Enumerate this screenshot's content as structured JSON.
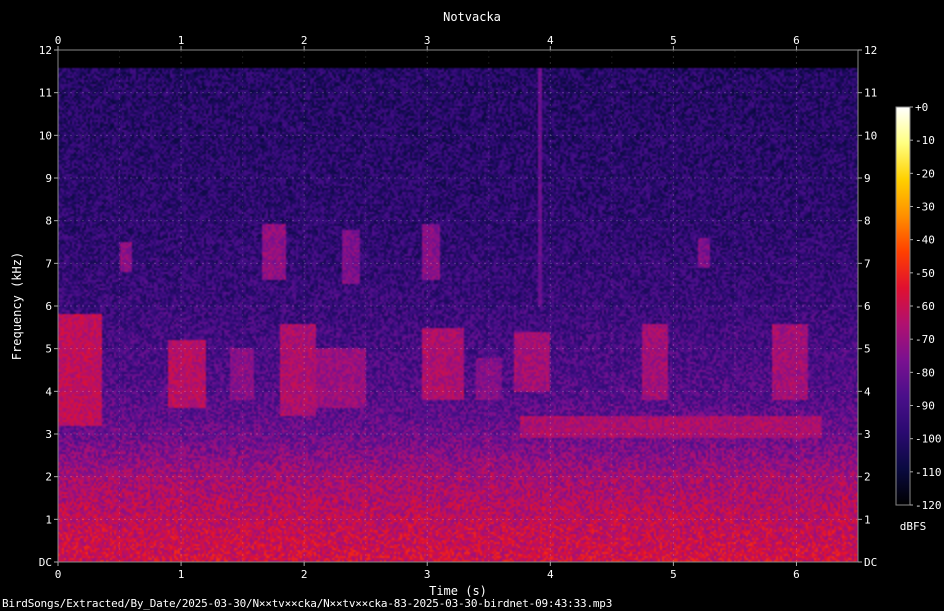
{
  "chart_data": {
    "type": "heatmap",
    "title": "Notvacka",
    "xlabel": "Time (s)",
    "ylabel": "Frequency (kHz)",
    "xlim": [
      0,
      6.5
    ],
    "ylim": [
      0,
      12
    ],
    "x_ticks": [
      {
        "value": 0,
        "label": "0"
      },
      {
        "value": 1,
        "label": "1"
      },
      {
        "value": 2,
        "label": "2"
      },
      {
        "value": 3,
        "label": "3"
      },
      {
        "value": 4,
        "label": "4"
      },
      {
        "value": 5,
        "label": "5"
      },
      {
        "value": 6,
        "label": "6"
      }
    ],
    "y_ticks": [
      {
        "value": 0,
        "label": "DC"
      },
      {
        "value": 1,
        "label": "1"
      },
      {
        "value": 2,
        "label": "2"
      },
      {
        "value": 3,
        "label": "3"
      },
      {
        "value": 4,
        "label": "4"
      },
      {
        "value": 5,
        "label": "5"
      },
      {
        "value": 6,
        "label": "6"
      },
      {
        "value": 7,
        "label": "7"
      },
      {
        "value": 8,
        "label": "8"
      },
      {
        "value": 9,
        "label": "9"
      },
      {
        "value": 10,
        "label": "10"
      },
      {
        "value": 11,
        "label": "11"
      },
      {
        "value": 12,
        "label": "12"
      }
    ],
    "colorbar": {
      "label": "dBFS",
      "range": [
        -120,
        0
      ],
      "ticks": [
        {
          "value": 0,
          "label": "+0"
        },
        {
          "value": -10,
          "label": "-10"
        },
        {
          "value": -20,
          "label": "-20"
        },
        {
          "value": -30,
          "label": "-30"
        },
        {
          "value": -40,
          "label": "-40"
        },
        {
          "value": -50,
          "label": "-50"
        },
        {
          "value": -60,
          "label": "-60"
        },
        {
          "value": -70,
          "label": "-70"
        },
        {
          "value": -80,
          "label": "-80"
        },
        {
          "value": -90,
          "label": "-90"
        },
        {
          "value": -100,
          "label": "-100"
        },
        {
          "value": -110,
          "label": "-110"
        },
        {
          "value": -120,
          "label": "-120"
        }
      ],
      "colormap": [
        "#000000",
        "#0a0a40",
        "#2a0a70",
        "#4a0f8a",
        "#7a1090",
        "#b01070",
        "#e01030",
        "#ff4000",
        "#ff9000",
        "#ffd000",
        "#ffff80",
        "#ffffff"
      ]
    },
    "grid": true,
    "signal_top_khz": 11.6,
    "noise_floor_dbfs": [
      {
        "khz": 0,
        "dbfs": -58
      },
      {
        "khz": 1,
        "dbfs": -62
      },
      {
        "khz": 2,
        "dbfs": -68
      },
      {
        "khz": 3,
        "dbfs": -80
      },
      {
        "khz": 4,
        "dbfs": -86
      },
      {
        "khz": 5,
        "dbfs": -89
      },
      {
        "khz": 6,
        "dbfs": -93
      },
      {
        "khz": 8,
        "dbfs": -97
      },
      {
        "khz": 11.6,
        "dbfs": -100
      }
    ],
    "events": [
      {
        "t0": 0.0,
        "t1": 0.35,
        "f0": 3.2,
        "f1": 5.8,
        "dbfs": -62
      },
      {
        "t0": 0.5,
        "t1": 0.6,
        "f0": 6.8,
        "f1": 7.5,
        "dbfs": -72
      },
      {
        "t0": 0.9,
        "t1": 1.2,
        "f0": 3.6,
        "f1": 5.2,
        "dbfs": -64
      },
      {
        "t0": 1.4,
        "t1": 1.6,
        "f0": 3.8,
        "f1": 5.0,
        "dbfs": -74
      },
      {
        "t0": 1.65,
        "t1": 1.85,
        "f0": 6.6,
        "f1": 7.9,
        "dbfs": -72
      },
      {
        "t0": 1.8,
        "t1": 2.1,
        "f0": 3.4,
        "f1": 5.6,
        "dbfs": -66
      },
      {
        "t0": 2.1,
        "t1": 2.5,
        "f0": 3.6,
        "f1": 5.0,
        "dbfs": -70
      },
      {
        "t0": 2.3,
        "t1": 2.45,
        "f0": 6.5,
        "f1": 7.8,
        "dbfs": -76
      },
      {
        "t0": 2.95,
        "t1": 3.1,
        "f0": 6.6,
        "f1": 7.9,
        "dbfs": -74
      },
      {
        "t0": 2.95,
        "t1": 3.3,
        "f0": 3.8,
        "f1": 5.5,
        "dbfs": -66
      },
      {
        "t0": 3.4,
        "t1": 3.6,
        "f0": 3.8,
        "f1": 4.8,
        "dbfs": -74
      },
      {
        "t0": 3.7,
        "t1": 4.0,
        "f0": 4.0,
        "f1": 5.4,
        "dbfs": -68
      },
      {
        "t0": 3.75,
        "t1": 6.2,
        "f0": 2.9,
        "f1": 3.4,
        "dbfs": -66
      },
      {
        "t0": 4.75,
        "t1": 4.95,
        "f0": 3.8,
        "f1": 5.6,
        "dbfs": -68
      },
      {
        "t0": 5.2,
        "t1": 5.3,
        "f0": 6.9,
        "f1": 7.6,
        "dbfs": -76
      },
      {
        "t0": 5.8,
        "t1": 6.1,
        "f0": 3.8,
        "f1": 5.6,
        "dbfs": -68
      }
    ],
    "transients": [
      {
        "t": 3.92,
        "f0": 6.0,
        "f1": 11.6,
        "dbfs": -80
      }
    ]
  },
  "file_label": "BirdSongs/Extracted/By_Date/2025-03-30/N××tv××cka/N××tv××cka-83-2025-03-30-birdnet-09:43:33.mp3"
}
